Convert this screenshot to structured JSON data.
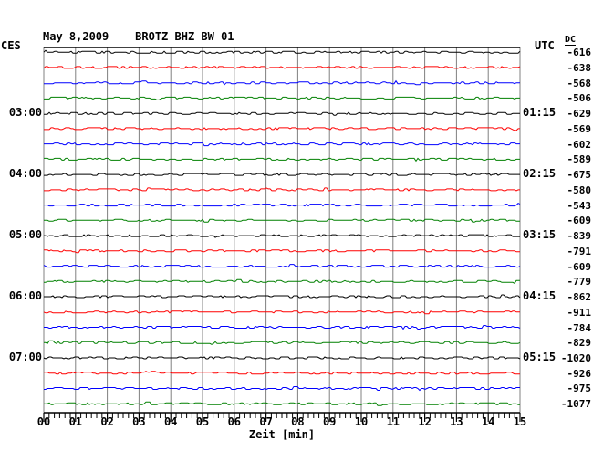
{
  "page": {
    "background": "#ffffff"
  },
  "chart_data": {
    "type": "line",
    "variant": "helicorder-seismogram-drum-plot",
    "title": "May 8,2009    BROTZ BHZ BW 01",
    "xlabel": "Zeit [min]",
    "xlim": [
      0,
      15
    ],
    "x_tick_labels": [
      "00",
      "01",
      "02",
      "03",
      "04",
      "05",
      "06",
      "07",
      "08",
      "09",
      "10",
      "11",
      "12",
      "13",
      "14",
      "15"
    ],
    "x_minor_ticks_per_minute": 6,
    "minutes_per_trace": 15,
    "grid": true,
    "legend_position": "none",
    "colors": {
      "grid": "#808080",
      "frame_top": "#000000",
      "axis": "#000000",
      "trace_black": "#000000",
      "trace_red": "#ff0000",
      "trace_blue": "#0000ff",
      "trace_green": "#008000"
    },
    "trace_color_cycle": [
      "#000000",
      "#ff0000",
      "#0000ff",
      "#008000"
    ],
    "left_time_axis": {
      "label": "CES"
    },
    "right_time_axis": {
      "label": "UTC"
    },
    "dc_column_header": "DC",
    "traces": [
      {
        "color": "black",
        "dc": -616
      },
      {
        "color": "red",
        "dc": -638
      },
      {
        "color": "blue",
        "dc": -568
      },
      {
        "color": "green",
        "dc": -506
      },
      {
        "color": "black",
        "dc": -629,
        "left_time": "03:00",
        "right_time": "01:15"
      },
      {
        "color": "red",
        "dc": -569
      },
      {
        "color": "blue",
        "dc": -602
      },
      {
        "color": "green",
        "dc": -589
      },
      {
        "color": "black",
        "dc": -675,
        "left_time": "04:00",
        "right_time": "02:15"
      },
      {
        "color": "red",
        "dc": -580
      },
      {
        "color": "blue",
        "dc": -543
      },
      {
        "color": "green",
        "dc": -609
      },
      {
        "color": "black",
        "dc": -839,
        "left_time": "05:00",
        "right_time": "03:15"
      },
      {
        "color": "red",
        "dc": -791
      },
      {
        "color": "blue",
        "dc": -609
      },
      {
        "color": "green",
        "dc": -779
      },
      {
        "color": "black",
        "dc": -862,
        "left_time": "06:00",
        "right_time": "04:15"
      },
      {
        "color": "red",
        "dc": -911
      },
      {
        "color": "blue",
        "dc": -784
      },
      {
        "color": "green",
        "dc": -829
      },
      {
        "color": "black",
        "dc": -1020,
        "left_time": "07:00",
        "right_time": "05:15"
      },
      {
        "color": "red",
        "dc": -926
      },
      {
        "color": "blue",
        "dc": -975
      },
      {
        "color": "green",
        "dc": -1077
      }
    ],
    "appearance": "all 24 traces show low-amplitude background noise, no visible seismic events"
  }
}
